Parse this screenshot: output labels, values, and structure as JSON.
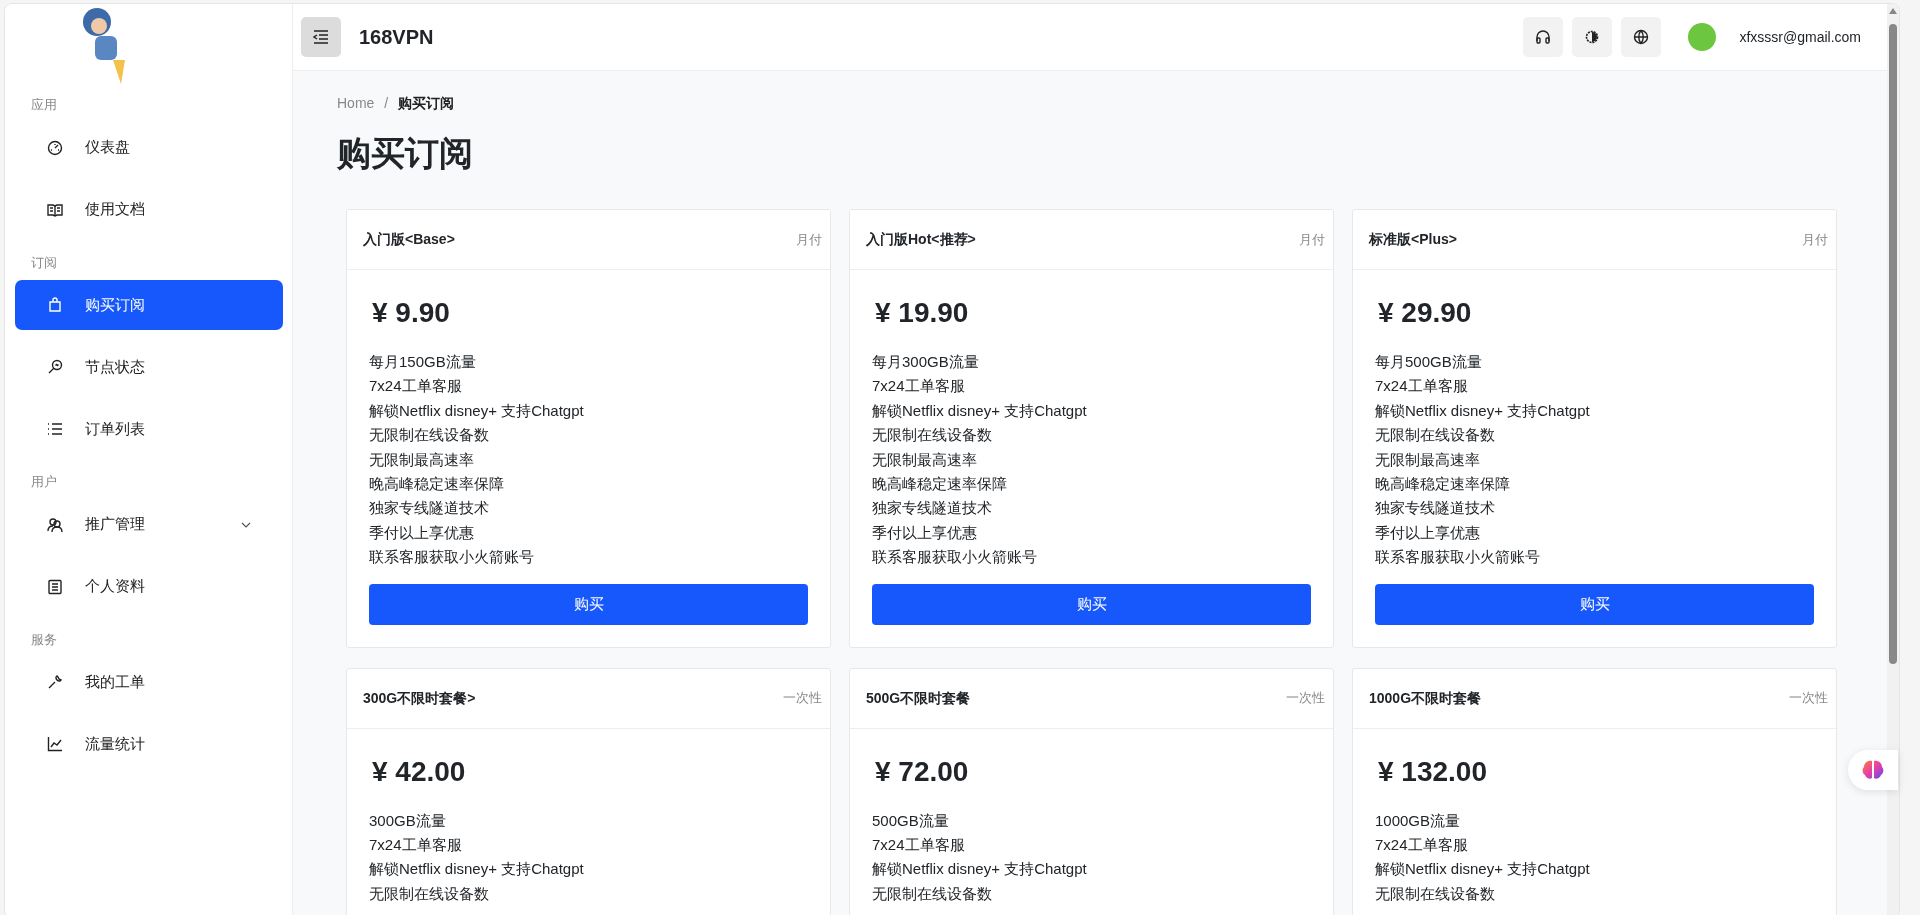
{
  "sidebar": {
    "sections": [
      {
        "title": "应用",
        "items": [
          {
            "label": "仪表盘",
            "selected": false
          },
          {
            "label": "使用文档",
            "selected": false
          }
        ]
      },
      {
        "title": "订阅",
        "items": [
          {
            "label": "购买订阅",
            "selected": true
          },
          {
            "label": "节点状态",
            "selected": false
          },
          {
            "label": "订单列表",
            "selected": false
          }
        ]
      },
      {
        "title": "用户",
        "items": [
          {
            "label": "推广管理",
            "selected": false,
            "expandable": true
          },
          {
            "label": "个人资料",
            "selected": false
          }
        ]
      },
      {
        "title": "服务",
        "items": [
          {
            "label": "我的工单",
            "selected": false
          },
          {
            "label": "流量统计",
            "selected": false
          }
        ]
      }
    ]
  },
  "header": {
    "title": "168VPN",
    "user_email": "xfxsssr@gmail.com"
  },
  "breadcrumb": [
    "Home",
    "购买订阅"
  ],
  "breadcrumb_separator": "/",
  "page_title": "购买订阅",
  "plans": [
    {
      "name": "入门版<Base>",
      "period": "月付",
      "price": "¥ 9.90",
      "features": [
        "每月150GB流量",
        "7x24工单客服",
        "解锁Netflix disney+ 支持Chatgpt",
        "无限制在线设备数",
        "无限制最高速率",
        "晚高峰稳定速率保障",
        "独家专线隧道技术",
        "季付以上享优惠",
        "联系客服获取小火箭账号"
      ],
      "button": "购买"
    },
    {
      "name": "入门版Hot<推荐>",
      "period": "月付",
      "price": "¥ 19.90",
      "features": [
        "每月300GB流量",
        "7x24工单客服",
        "解锁Netflix disney+ 支持Chatgpt",
        "无限制在线设备数",
        "无限制最高速率",
        "晚高峰稳定速率保障",
        "独家专线隧道技术",
        "季付以上享优惠",
        "联系客服获取小火箭账号"
      ],
      "button": "购买"
    },
    {
      "name": "标准版<Plus>",
      "period": "月付",
      "price": "¥ 29.90",
      "features": [
        "每月500GB流量",
        "7x24工单客服",
        "解锁Netflix disney+ 支持Chatgpt",
        "无限制在线设备数",
        "无限制最高速率",
        "晚高峰稳定速率保障",
        "独家专线隧道技术",
        "季付以上享优惠",
        "联系客服获取小火箭账号"
      ],
      "button": "购买"
    },
    {
      "name": "300G不限时套餐>",
      "period": "一次性",
      "price": "¥ 42.00",
      "features": [
        "300GB流量",
        "7x24工单客服",
        "解锁Netflix disney+ 支持Chatgpt",
        "无限制在线设备数"
      ]
    },
    {
      "name": "500G不限时套餐",
      "period": "一次性",
      "price": "¥ 72.00",
      "features": [
        "500GB流量",
        "7x24工单客服",
        "解锁Netflix disney+ 支持Chatgpt",
        "无限制在线设备数"
      ]
    },
    {
      "name": "1000G不限时套餐",
      "period": "一次性",
      "price": "¥ 132.00",
      "features": [
        "1000GB流量",
        "7x24工单客服",
        "解锁Netflix disney+ 支持Chatgpt",
        "无限制在线设备数"
      ]
    }
  ]
}
